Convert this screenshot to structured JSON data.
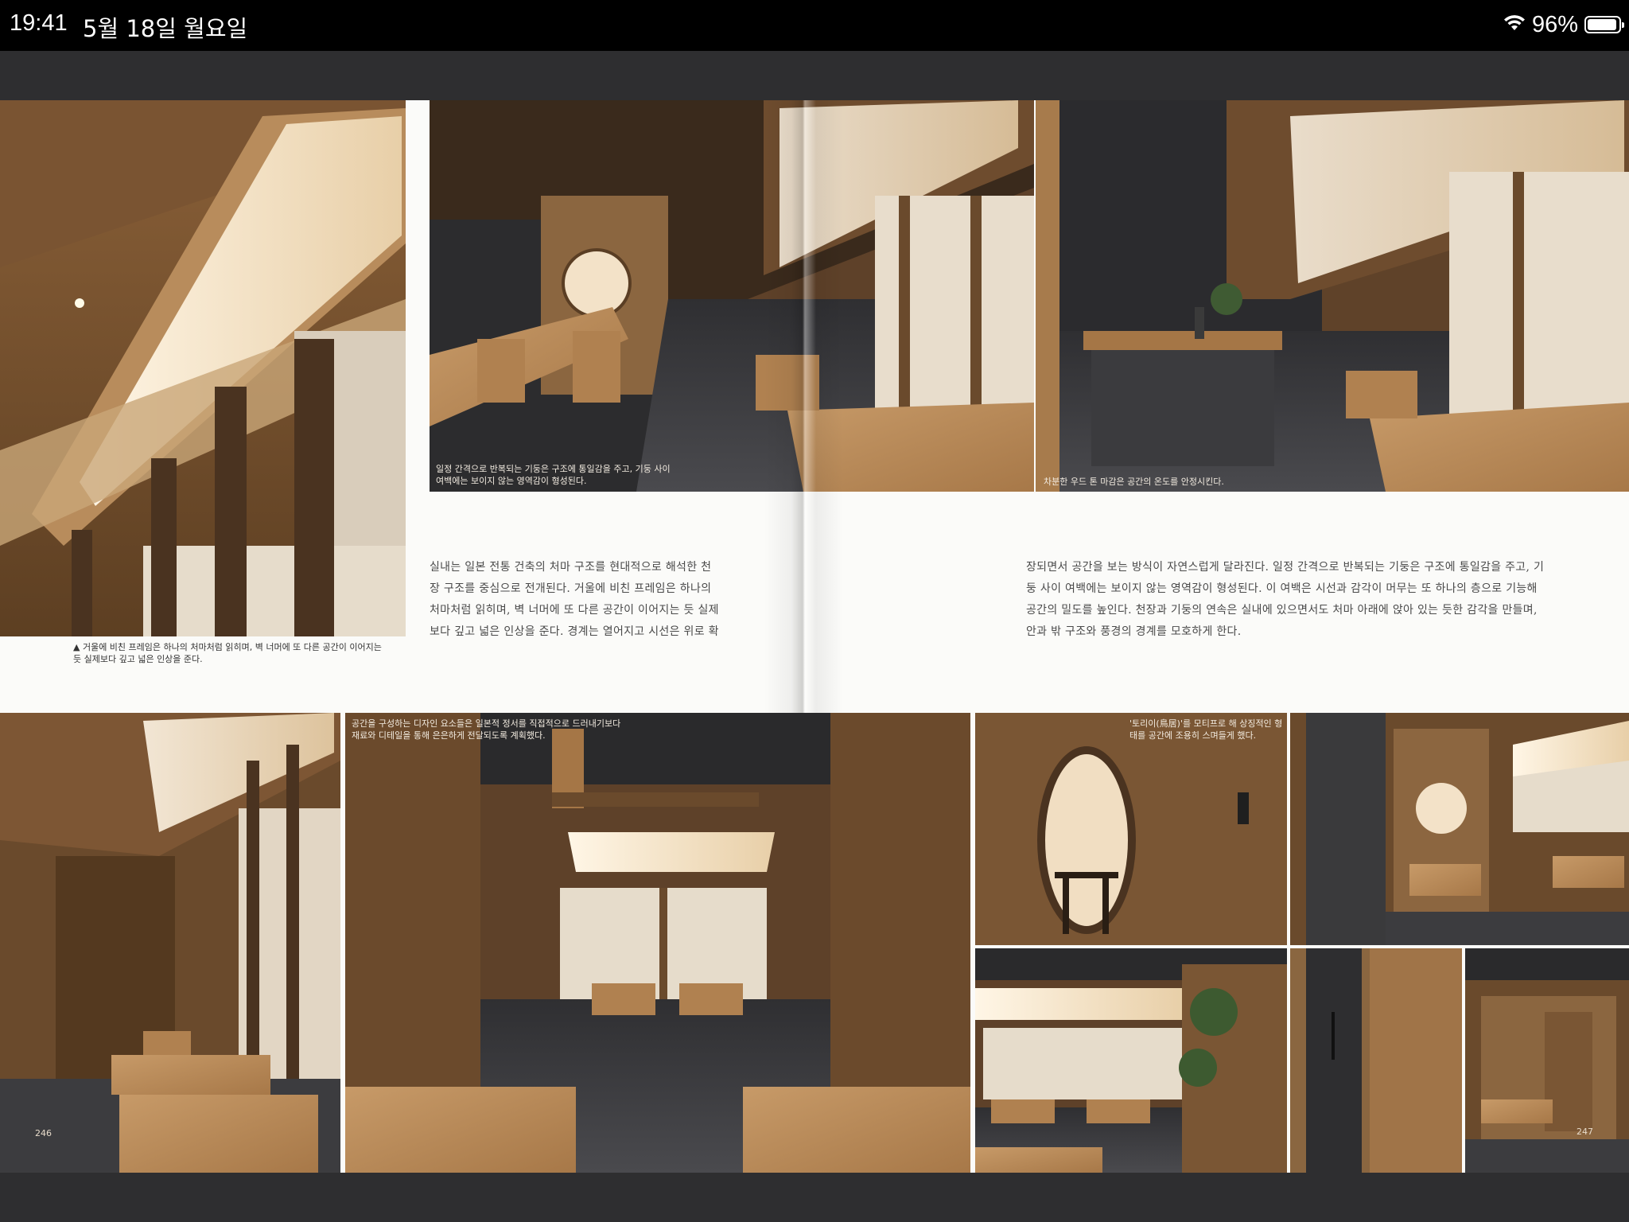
{
  "status_bar": {
    "time": "19:41",
    "date": "5월 18일 월요일",
    "battery": "96%",
    "battery_level": 0.96
  },
  "captions": {
    "top_left": "▲ 거울에 비친 프레임은 하나의 처마처럼 읽히며, 벽 너머에 또 다른 공간이 이어지는 듯 실제보다 깊고 넓은 인상을 준다.",
    "top_middle": "일정 간격으로 반복되는 기둥은 구조에 통일감을 주고, 기둥 사이 여백에는 보이지 않는 영역감이 형성된다.",
    "top_right": "차분한 우드 톤 마감은 공간의 온도를 안정시킨다.",
    "bottom_middle": "공간을 구성하는 디자인 요소들은 일본적 정서를 직접적으로 드러내기보다 재료와 디테일을 통해 은은하게 전달되도록 계획했다.",
    "bottom_right": "'토리이(鳥居)'를 모티프로 해 상징적인 형태를 공간에 조용히 스며들게 했다."
  },
  "body": {
    "left_lines": [
      "실내는 일본 전통 건축의 처마 구조를 현대적으로 해석한 천",
      "장 구조를 중심으로 전개된다. 거울에 비친 프레임은 하나의",
      "처마처럼 읽히며, 벽 너머에 또 다른 공간이 이어지는 듯 실제",
      "보다 깊고 넓은 인상을 준다. 경계는 열어지고 시선은 위로 확"
    ],
    "right_lines": [
      "장되면서 공간을 보는 방식이 자연스럽게 달라진다. 일정 간격으로 반복되는 기둥은 구조에 통일감을 주고, 기",
      "둥 사이 여백에는 보이지 않는 영역감이 형성된다. 이 여백은 시선과 감각이 머무는 또 하나의 층으로 기능해",
      "공간의 밀도를 높인다. 천장과 기둥의 연속은 실내에 있으면서도 처마 아래에 앉아 있는 듯한 감각을 만들며,",
      "안과 밖 구조와 풍경의 경계를 모호하게 한다."
    ]
  },
  "page_numbers": {
    "left": "246",
    "right": "247"
  },
  "colors": {
    "wood": "#a87a4d",
    "wood_dark": "#5a3e24",
    "paper": "#fbfbf9",
    "floor": "#3c3c3f",
    "glow": "#f6ead6"
  },
  "icons": [
    "wifi-icon",
    "battery-icon"
  ]
}
